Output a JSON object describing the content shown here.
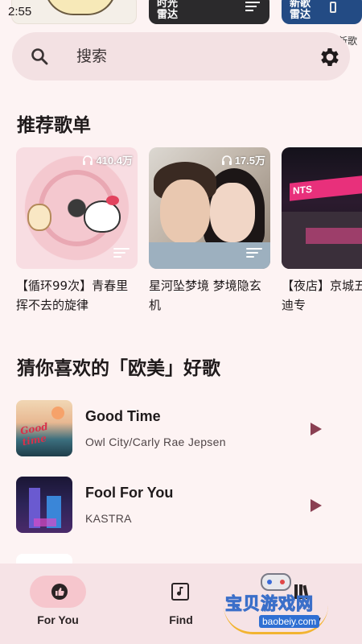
{
  "status_bar": {
    "time": "2:55"
  },
  "top_banners": [
    {
      "text": ""
    },
    {
      "text": "时光雷达"
    },
    {
      "text": "新歌雷达"
    }
  ],
  "top_banner_caption": "新歌",
  "search": {
    "placeholder": "搜索",
    "value": ""
  },
  "sections": {
    "playlists_title": "推荐歌单",
    "recommend_title": "猜你喜欢的「欧美」好歌"
  },
  "playlists": [
    {
      "name": "【循环99次】青春里挥不去的旋律",
      "play_count": "410.4万"
    },
    {
      "name": "星河坠梦境 梦境隐玄机",
      "play_count": "17.5万"
    },
    {
      "name": "【夜店】京城五道口蹦迪专",
      "play_count": ""
    }
  ],
  "songs": [
    {
      "title": "Good Time",
      "artist": "Owl City/Carly Rae Jepsen",
      "art_text": "Good time"
    },
    {
      "title": "Fool For You",
      "artist": "KASTRA"
    }
  ],
  "nav": {
    "items": [
      {
        "label": "For You",
        "icon": "thumb-up-icon",
        "active": true
      },
      {
        "label": "Find",
        "icon": "music-note-icon",
        "active": false
      },
      {
        "label": "Library",
        "icon": "library-icon",
        "active": false
      }
    ]
  },
  "watermark": {
    "text": "宝贝游戏网",
    "url": "baobeiy.com"
  },
  "colors": {
    "background": "#fdf3f3",
    "search_bg": "#f3e1e3",
    "nav_bg": "#f6e3e6",
    "nav_active_pill": "#f6c6cd",
    "play_accent": "#8a3f52"
  }
}
